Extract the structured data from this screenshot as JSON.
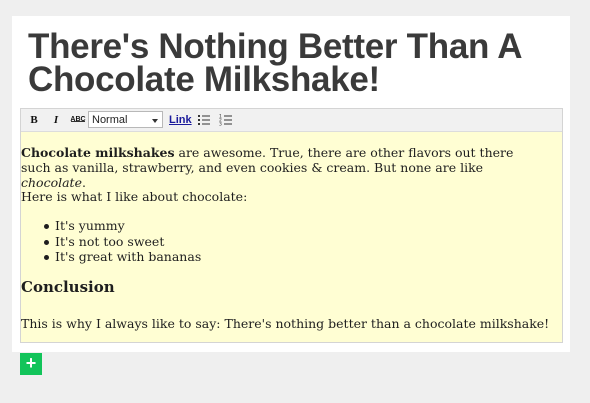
{
  "post": {
    "title": "There's Nothing Better Than A Chocolate Milkshake!"
  },
  "toolbar": {
    "bold_label": "B",
    "italic_label": "I",
    "spellcheck_label": "ABC",
    "format_select": {
      "value": "Normal"
    },
    "link_label": "Link",
    "icons": {
      "bold": "bold-icon",
      "italic": "italic-icon",
      "spellcheck": "spellcheck-icon",
      "bulleted_list": "bulleted-list-icon",
      "numbered_list": "numbered-list-icon"
    }
  },
  "content": {
    "p1_bold": "Chocolate milkshakes",
    "p1_text": " are awesome. True, there are other flavors out there such as vanilla, strawberry, and even cookies & cream. But none are like ",
    "p1_italic": "chocolate",
    "p1_end": ".",
    "p2": "Here is what I like about chocolate:",
    "list": [
      "It's yummy",
      "It's not too sweet",
      "It's great with bananas"
    ],
    "heading": "Conclusion",
    "p3": "This is why I always like to say: There's nothing better than a chocolate milkshake!"
  },
  "add_button": {
    "label": "+",
    "icon": "plus-icon"
  },
  "colors": {
    "page_bg": "#efefef",
    "editor_bg": "#fffed3",
    "toolbar_bg": "#f1f1f1",
    "add_button": "#12c45a",
    "link": "#1a1a9c"
  }
}
